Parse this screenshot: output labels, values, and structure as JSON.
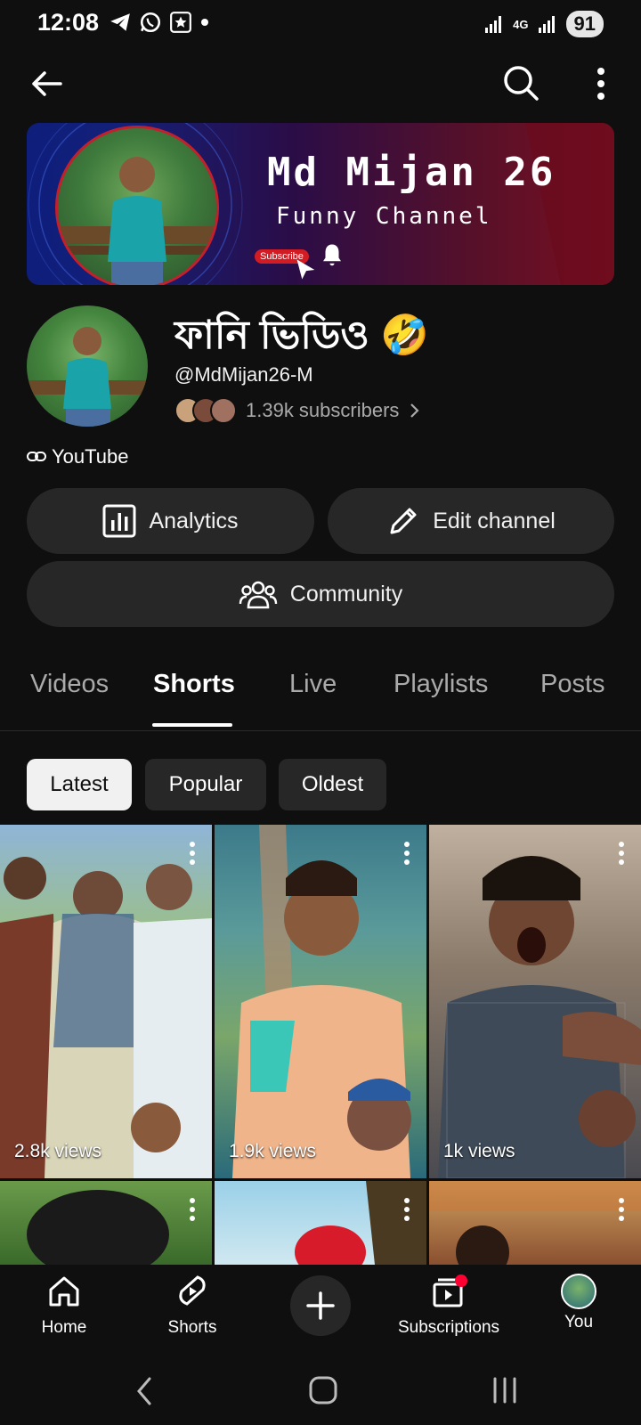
{
  "status_bar": {
    "time": "12:08",
    "network": "4G",
    "battery": "91"
  },
  "banner": {
    "title": "Md Mijan 26",
    "subtitle": "Funny Channel",
    "subscribe_label": "Subscribe"
  },
  "channel": {
    "name": "ফানি ভিডিও 🤣",
    "handle": "@MdMijan26-M",
    "subscribers": "1.39k subscribers",
    "link": "YouTube"
  },
  "actions": {
    "analytics": "Analytics",
    "edit_channel": "Edit channel",
    "community": "Community"
  },
  "tabs": [
    "Videos",
    "Shorts",
    "Live",
    "Playlists",
    "Posts"
  ],
  "active_tab": "Shorts",
  "chips": [
    "Latest",
    "Popular",
    "Oldest"
  ],
  "active_chip": "Latest",
  "shorts": [
    {
      "views": "2.8k views"
    },
    {
      "views": "1.9k views"
    },
    {
      "views": "1k views"
    }
  ],
  "bottom_nav": {
    "home": "Home",
    "shorts": "Shorts",
    "subscriptions": "Subscriptions",
    "you": "You"
  },
  "colors": {
    "background": "#0f0f0f",
    "pill": "#272727",
    "accent_red": "#ff0033"
  }
}
